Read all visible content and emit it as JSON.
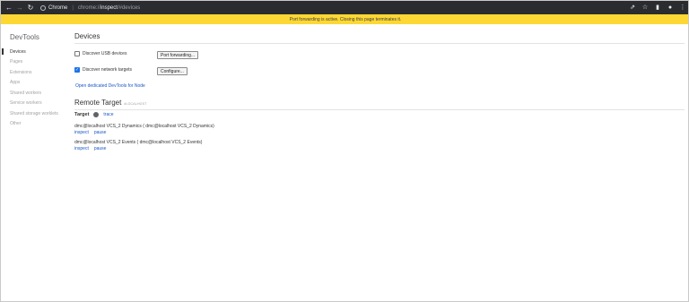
{
  "browser": {
    "site_label": "Chrome",
    "url_prefix": "chrome://",
    "url_host": "inspect",
    "url_path": "/#devices"
  },
  "infobar": {
    "message": "Port forwarding is active. Closing this page terminates it."
  },
  "sidebar": {
    "title": "DevTools",
    "items": [
      {
        "label": "Devices"
      },
      {
        "label": "Pages"
      },
      {
        "label": "Extensions"
      },
      {
        "label": "Apps"
      },
      {
        "label": "Shared workers"
      },
      {
        "label": "Service workers"
      },
      {
        "label": "Shared storage worklets"
      },
      {
        "label": "Other"
      }
    ]
  },
  "devices": {
    "title": "Devices",
    "discover_usb_label": "Discover USB devices",
    "discover_usb_checked": false,
    "port_forwarding_button": "Port forwarding...",
    "discover_network_label": "Discover network targets",
    "discover_network_checked": true,
    "configure_button": "Configure...",
    "open_devtools_link": "Open dedicated DevTools for Node"
  },
  "remote_target": {
    "title": "Remote Target",
    "badge": "#LOCALHOST",
    "target_label": "Target",
    "trace_link": "trace",
    "targets": [
      {
        "name": "dmc@localhost VCS_2 Dynamics ( dmc@localhost VCS_2 Dynamics)",
        "inspect": "inspect",
        "pause": "pause"
      },
      {
        "name": "dmc@localhost VCS_2 Events ( dmc@localhost VCS_2 Events)",
        "inspect": "inspect",
        "pause": "pause"
      }
    ]
  },
  "colors": {
    "toolbar_bg": "#2b2c30",
    "infobar_bg": "#fdd835",
    "link": "#1a56c9"
  }
}
